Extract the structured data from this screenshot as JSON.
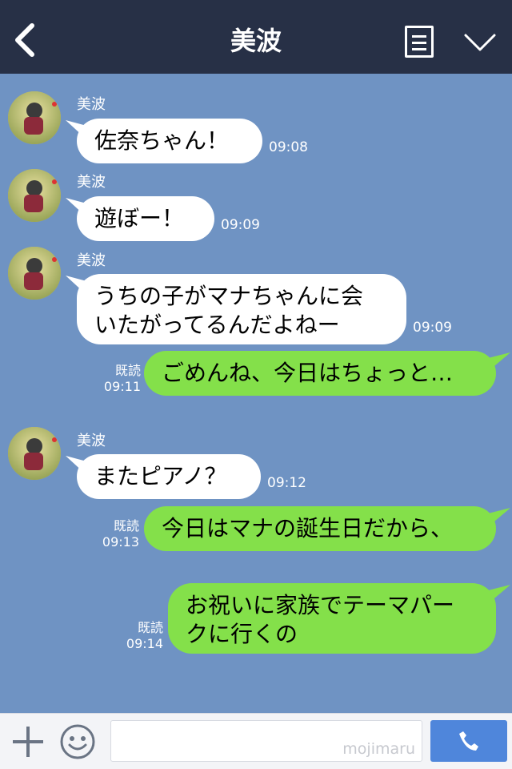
{
  "header": {
    "title": "美波",
    "back_icon": "chevron-left-icon",
    "menu_icon": "list-icon",
    "collapse_icon": "chevron-down-icon"
  },
  "messages": [
    {
      "from": "美波",
      "text": "佐奈ちゃん！",
      "time": "09:08"
    },
    {
      "from": "美波",
      "text": "遊ぼー！",
      "time": "09:09"
    },
    {
      "from": "美波",
      "line1": "うちの子がマナちゃんに会",
      "line2": "いたがってるんだよねー",
      "time": "09:09"
    },
    {
      "from": "me",
      "read": "既読",
      "time": "09:11",
      "text": "ごめんね、今日はちょっと…"
    },
    {
      "from": "美波",
      "text": "またピアノ？",
      "time": "09:12"
    },
    {
      "from": "me",
      "read": "既読",
      "time": "09:13",
      "text": "今日はマナの誕生日だから、"
    },
    {
      "from": "me",
      "read": "既読",
      "time": "09:14",
      "line1": "お祝いに家族でテーマパー",
      "line2": "クに行くの"
    }
  ],
  "footer": {
    "input_value": "",
    "watermark": "mojimaru",
    "add_icon": "plus-icon",
    "emoji_icon": "smiley-icon",
    "call_icon": "phone-icon"
  },
  "colors": {
    "header_bg": "#273046",
    "chat_bg": "#6f93c3",
    "left_bubble": "#ffffff",
    "right_bubble": "#84e04a",
    "call_button": "#4f86db"
  }
}
